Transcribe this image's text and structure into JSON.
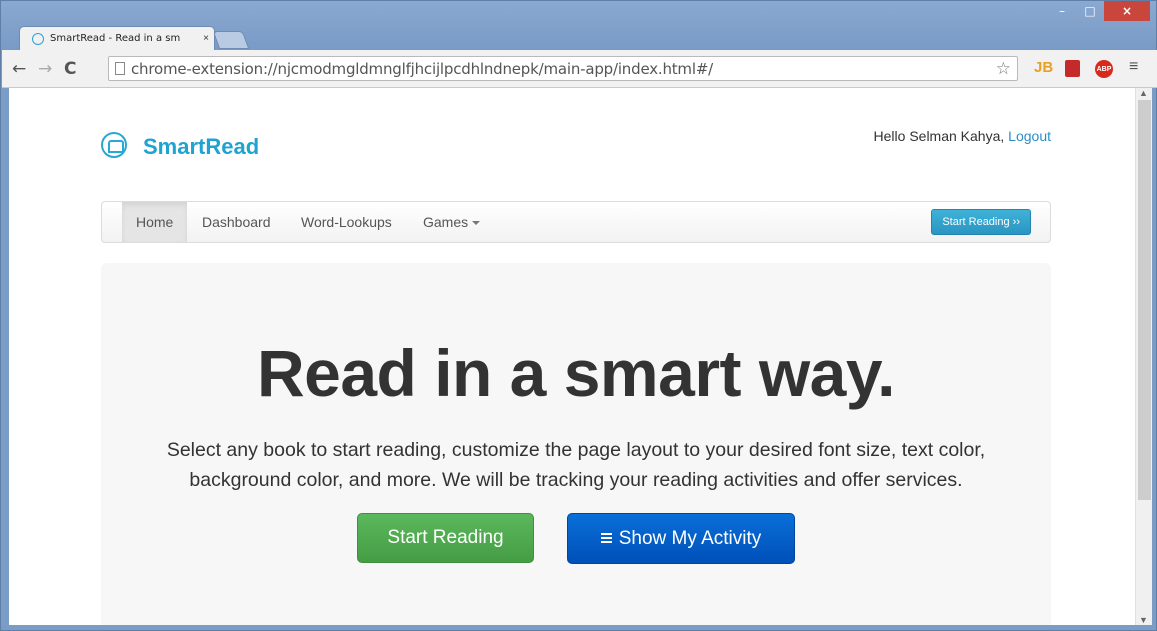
{
  "browser": {
    "tab_title": "SmartRead - Read in a sm",
    "tab_close": "×",
    "url": "chrome-extension://njcmodmgldmnglfjhcijlpcdhlndnepk/main-app/index.html#/",
    "back": "←",
    "forward": "→",
    "reload": "C",
    "star": "☆",
    "ext_jb": "JB",
    "ext_abp": "ABP",
    "menu": "≡",
    "win_min": "–",
    "win_max": "□",
    "win_close": "×"
  },
  "header": {
    "brand": "SmartRead",
    "greeting": "Hello Selman Kahya,",
    "logout": "Logout"
  },
  "nav": {
    "items": [
      {
        "label": "Home",
        "active": true
      },
      {
        "label": "Dashboard",
        "active": false
      },
      {
        "label": "Word-Lookups",
        "active": false
      },
      {
        "label": "Games",
        "active": false
      }
    ],
    "cta": "Start Reading ››"
  },
  "hero": {
    "title": "Read in a smart way.",
    "text": "Select any book to start reading, customize the page layout to your desired font size, text color, background color, and more. We will be tracking your reading activities and offer services.",
    "primary_button": "Start Reading",
    "secondary_button": "Show My Activity"
  },
  "colors": {
    "brand": "#1fa3d0",
    "primary_button": "#5cb85c",
    "secondary_button": "#0a6fd8",
    "link": "#2a8ec8"
  }
}
